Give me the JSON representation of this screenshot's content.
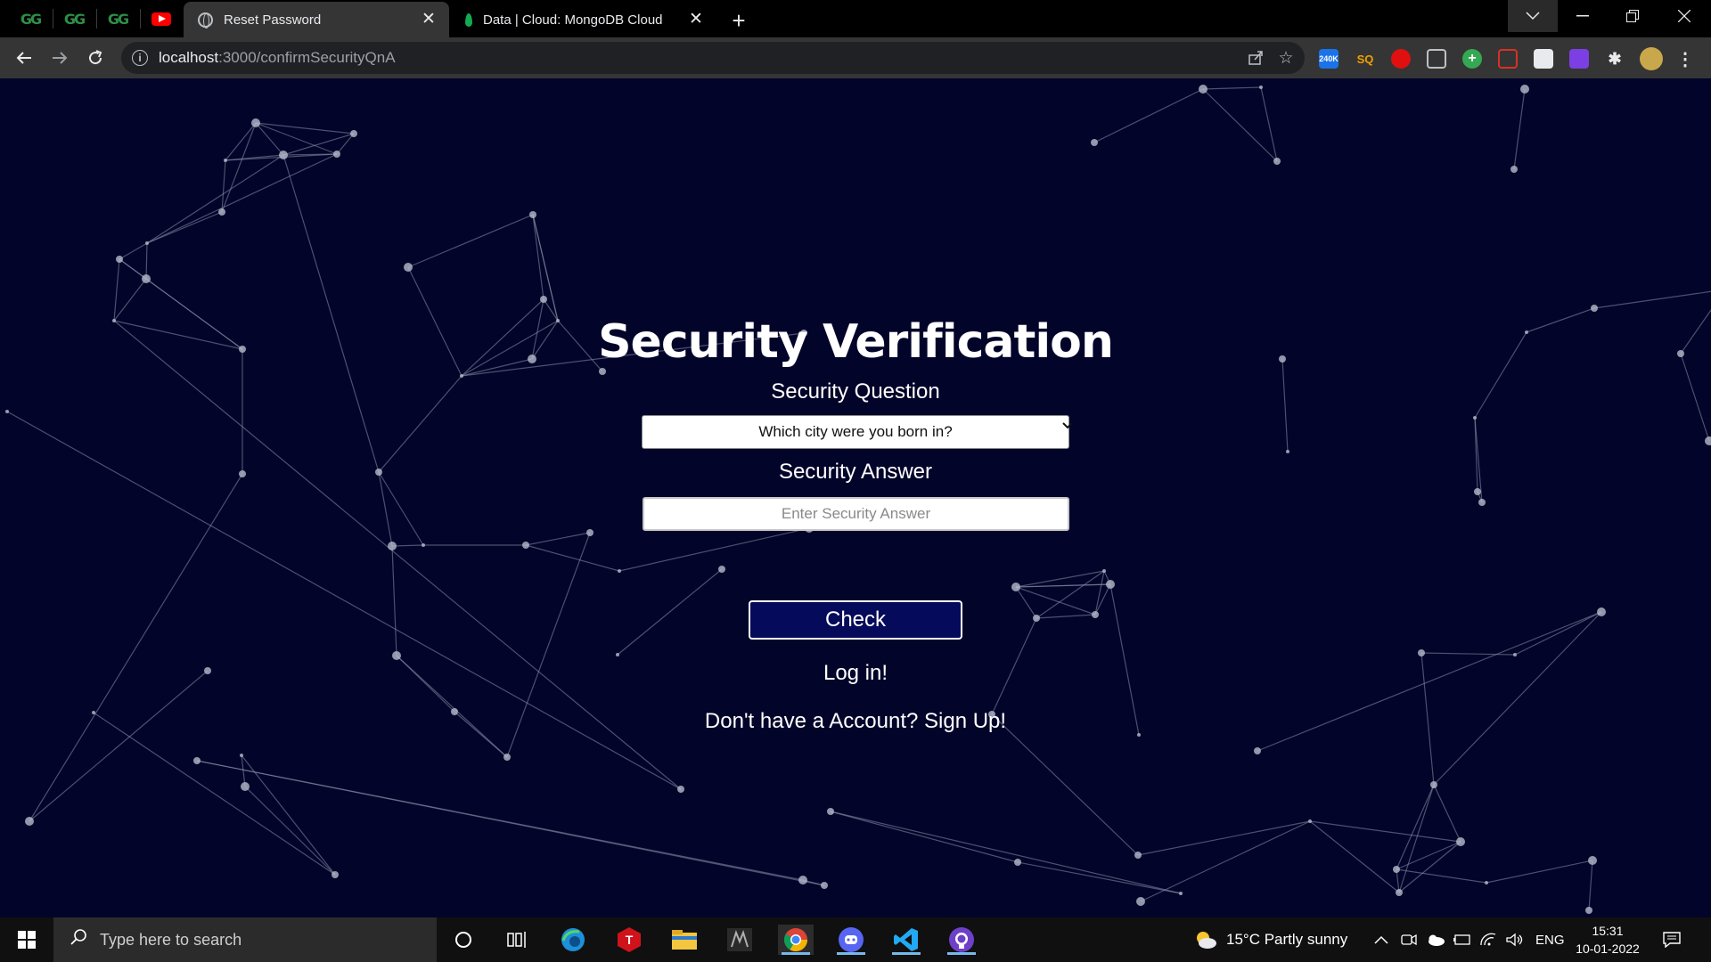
{
  "browser": {
    "pinned_tabs": [
      {
        "icon": "geeksforgeeks-icon",
        "glyph": "GG"
      },
      {
        "icon": "geeksforgeeks-icon",
        "glyph": "GG"
      },
      {
        "icon": "geeksforgeeks-icon",
        "glyph": "GG"
      },
      {
        "icon": "youtube-icon"
      }
    ],
    "tabs": [
      {
        "title": "Reset Password",
        "icon": "globe-icon",
        "active": true
      },
      {
        "title": "Data | Cloud: MongoDB Cloud",
        "icon": "mongodb-leaf-icon",
        "active": false
      }
    ],
    "new_tab_glyph": "+",
    "close_glyph": "✕",
    "url_host": "localhost",
    "url_rest": ":3000/confirmSecurityQnA",
    "extensions": [
      {
        "icon": "extension-240k-icon",
        "badge": "240K",
        "color": "#1a73e8"
      },
      {
        "icon": "extension-sq-icon",
        "badge": "SQ",
        "color": "#f0a000"
      },
      {
        "icon": "extension-stop-icon",
        "color": "#e01010"
      },
      {
        "icon": "extension-glasses-icon",
        "color": "#5f6368"
      },
      {
        "icon": "extension-plus-icon",
        "color": "#34a853"
      },
      {
        "icon": "extension-chart-icon",
        "color": "#d93025"
      },
      {
        "icon": "extension-bars-icon",
        "color": "#5f6368"
      },
      {
        "icon": "extension-purple-icon",
        "color": "#7b3fe4"
      },
      {
        "icon": "puzzle-icon",
        "color": "#bdc1c6"
      }
    ]
  },
  "page": {
    "title": "Security Verification",
    "question_label": "Security Question",
    "question_selected": "Which city were you born in?",
    "answer_label": "Security Answer",
    "answer_placeholder": "Enter Security Answer",
    "check_button": "Check",
    "login_link": "Log in!",
    "signup_link": "Don't have a Account? Sign Up!",
    "colors": {
      "background": "#03042a",
      "button": "#050a5a",
      "network": "#8a8fa8"
    }
  },
  "taskbar": {
    "search_placeholder": "Type here to search",
    "apps": [
      "cortana-icon",
      "task-view-icon",
      "edge-icon",
      "t-app-icon",
      "file-explorer-icon",
      "acer-app-icon",
      "chrome-icon",
      "discord-icon",
      "vscode-icon",
      "github-desktop-icon"
    ],
    "weather": "15°C  Partly sunny",
    "language": "ENG",
    "time": "15:31",
    "date": "10-01-2022"
  }
}
